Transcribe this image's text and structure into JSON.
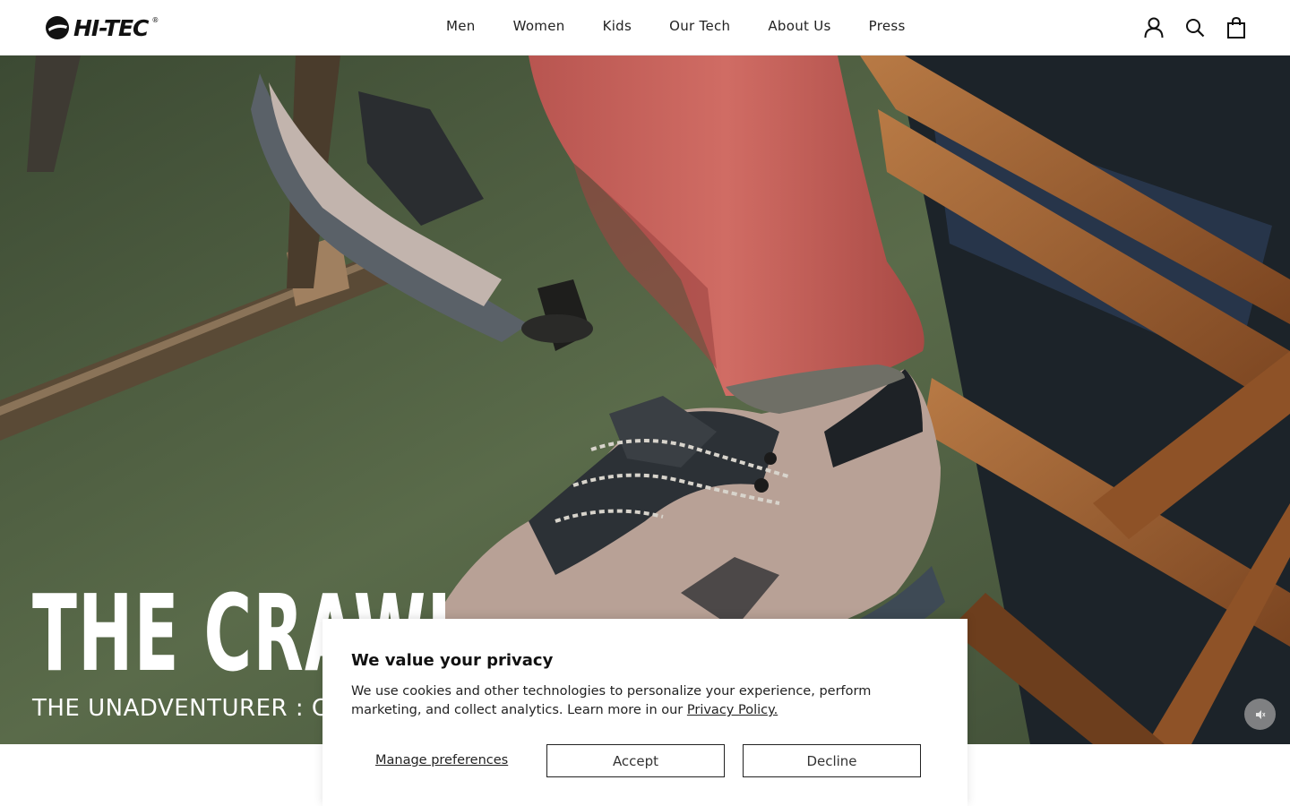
{
  "brand": {
    "name": "HI-TEC",
    "reg": "®"
  },
  "nav": {
    "items": [
      "Men",
      "Women",
      "Kids",
      "Our Tech",
      "About Us",
      "Press"
    ]
  },
  "header_icons": [
    "account-icon",
    "search-icon",
    "cart-icon"
  ],
  "hero": {
    "title": "THE CRAWL",
    "subtitle": "THE UNADVENTURER : CH"
  },
  "cookie": {
    "title": "We value your privacy",
    "text": "We use cookies and other technologies to personalize your experience, perform marketing, and collect analytics. Learn more in our ",
    "link": "Privacy Policy.",
    "manage": "Manage preferences",
    "accept": "Accept",
    "decline": "Decline"
  },
  "colors": {
    "pants": "#c8605a",
    "floor": "#4f6040",
    "wood": "#9a5a2c"
  }
}
